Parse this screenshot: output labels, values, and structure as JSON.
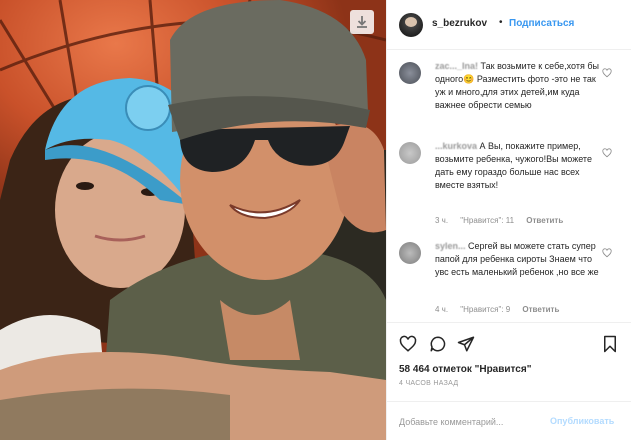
{
  "post": {
    "username": "s_bezrukov",
    "dot": "•",
    "follow_label": "Подписаться"
  },
  "comments": [
    {
      "author": "zac..._Ina!",
      "text": "Так возьмите к себе,хотя бы одного😊 Разместить фото -это не так уж и много,для этих детей,им куда важнее обрести семью",
      "time": "",
      "likes": "",
      "reply": ""
    },
    {
      "author": "...kurkova",
      "text": "А Вы, покажите пример, возьмите ребенка, чужого!Вы можете дать ему гораздо больше нас всех вместе взятых!",
      "time": "3 ч.",
      "likes": "\"Нравится\": 11",
      "reply": "Ответить"
    },
    {
      "author": "sylen...",
      "text": "Сергей вы можете стать супер папой для ребенка сироты Знаем что увс есть маленький ребенок ,но все же",
      "time": "4 ч.",
      "likes": "\"Нравится\": 9",
      "reply": "Ответить"
    }
  ],
  "actions": {
    "likes_text": "58 464 отметок \"Нравится\"",
    "time_ago": "4 ЧАСОВ НАЗАД"
  },
  "add_comment": {
    "placeholder": "Добавьте комментарий...",
    "publish_label": "Опубликовать"
  },
  "colors": {
    "link_blue": "#3897f0",
    "publish_disabled": "#b3dbff",
    "meta_gray": "#8e8e8e"
  },
  "icons": [
    "download-icon",
    "heart-icon",
    "comment-icon",
    "share-icon",
    "bookmark-icon"
  ]
}
